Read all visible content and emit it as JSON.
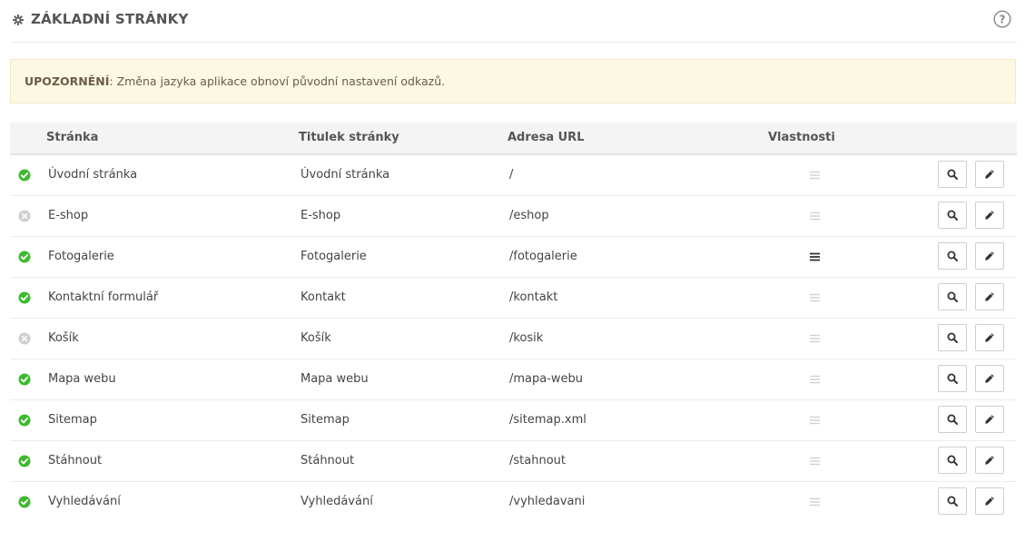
{
  "header": {
    "title": "ZÁKLADNÍ STRÁNKY"
  },
  "notice": {
    "label": "UPOZORNĚNÍ",
    "separator": ":",
    "text": " Změna jazyka aplikace obnoví původní nastavení odkazů."
  },
  "table": {
    "columns": {
      "page": "Stránka",
      "title": "Titulek stránky",
      "url": "Adresa URL",
      "properties": "Vlastnosti"
    },
    "rows": [
      {
        "active": true,
        "page": "Úvodní stránka",
        "title": "Úvodní stránka",
        "url": "/",
        "properties_set": false
      },
      {
        "active": false,
        "page": "E-shop",
        "title": "E-shop",
        "url": "/eshop",
        "properties_set": false
      },
      {
        "active": true,
        "page": "Fotogalerie",
        "title": "Fotogalerie",
        "url": "/fotogalerie",
        "properties_set": true
      },
      {
        "active": true,
        "page": "Kontaktní formulář",
        "title": "Kontakt",
        "url": "/kontakt",
        "properties_set": false
      },
      {
        "active": false,
        "page": "Košík",
        "title": "Košík",
        "url": "/kosik",
        "properties_set": false
      },
      {
        "active": true,
        "page": "Mapa webu",
        "title": "Mapa webu",
        "url": "/mapa-webu",
        "properties_set": false
      },
      {
        "active": true,
        "page": "Sitemap",
        "title": "Sitemap",
        "url": "/sitemap.xml",
        "properties_set": false
      },
      {
        "active": true,
        "page": "Stáhnout",
        "title": "Stáhnout",
        "url": "/stahnout",
        "properties_set": false
      },
      {
        "active": true,
        "page": "Vyhledávání",
        "title": "Vyhledávání",
        "url": "/vyhledavani",
        "properties_set": false
      }
    ]
  },
  "icons": {
    "gear": "gear-icon",
    "help": "help-icon",
    "status_on": "check-circle-icon",
    "status_off": "x-circle-icon",
    "properties": "menu-lines-icon",
    "view": "search-icon",
    "edit": "pencil-icon"
  },
  "colors": {
    "status_on": "#3dba2d",
    "status_off": "#cfcfcf",
    "properties_on": "#333333",
    "properties_off": "#d0d0d0",
    "notice_bg": "#fcf8e3"
  }
}
